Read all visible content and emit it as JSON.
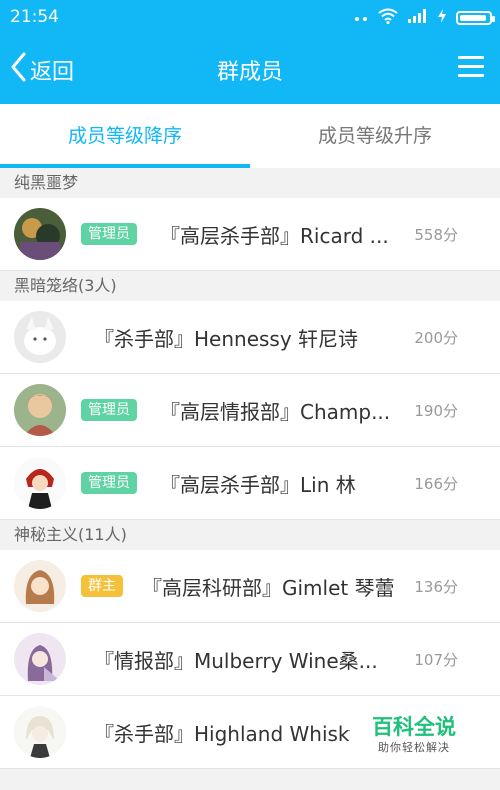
{
  "status": {
    "time": "21:54",
    "signal": "·· ",
    "wifi": "≋"
  },
  "header": {
    "back_label": "返回",
    "title": "群成员"
  },
  "tabs": [
    {
      "label": "成员等级降序",
      "active": true
    },
    {
      "label": "成员等级升序",
      "active": false
    }
  ],
  "groups": [
    {
      "title": "纯黑噩梦",
      "members": [
        {
          "badge": "管理员",
          "name": "『高层杀手部』Ricard ...",
          "score": "558分"
        }
      ]
    },
    {
      "title": "黑暗笼络(3人)",
      "members": [
        {
          "badge": "",
          "name": "『杀手部』Hennessy 轩尼诗",
          "score": "200分"
        },
        {
          "badge": "管理员",
          "name": "『高层情报部』Champ...",
          "score": "190分"
        },
        {
          "badge": "管理员",
          "name": "『高层杀手部』Lin 林",
          "score": "166分"
        }
      ]
    },
    {
      "title": "神秘主义(11人)",
      "members": [
        {
          "badge": "群主",
          "name": "『高层科研部』Gimlet 琴蕾",
          "score": "136分"
        },
        {
          "badge": "",
          "name": "『情报部』Mulberry Wine桑...",
          "score": "107分"
        },
        {
          "badge": "",
          "name": "『杀手部』Highland Whisky",
          "score": ""
        }
      ]
    }
  ],
  "watermark": {
    "title": "百科全说",
    "subtitle": "助你轻松解决"
  },
  "colors": {
    "accent": "#12b7f5",
    "admin_badge": "#5fd3a4",
    "owner_badge": "#f5c13a"
  }
}
